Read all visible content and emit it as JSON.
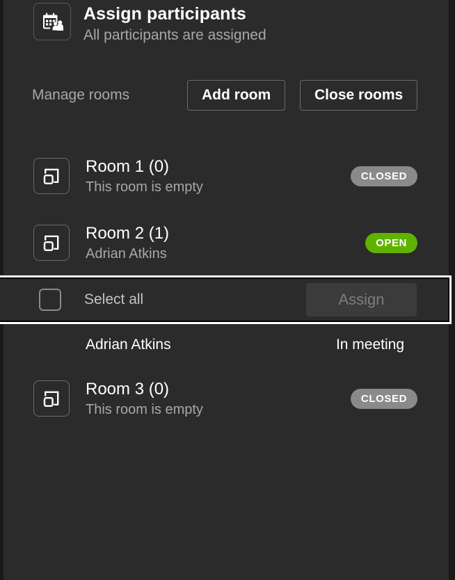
{
  "header": {
    "icon": "calendar-people-icon",
    "title": "Assign participants",
    "subtitle": "All participants are assigned"
  },
  "manage": {
    "label": "Manage rooms",
    "add_room_label": "Add room",
    "close_rooms_label": "Close rooms"
  },
  "rooms": [
    {
      "icon": "room-icon",
      "name": "Room 1 (0)",
      "description": "This room is empty",
      "status": "CLOSED",
      "status_type": "closed"
    },
    {
      "icon": "room-icon",
      "name": "Room 2 (1)",
      "description": "Adrian Atkins",
      "status": "OPEN",
      "status_type": "open"
    },
    {
      "icon": "room-icon",
      "name": "Room 3 (0)",
      "description": "This room is empty",
      "status": "CLOSED",
      "status_type": "closed"
    }
  ],
  "select_all": {
    "label": "Select all",
    "checked": false,
    "assign_label": "Assign",
    "assign_disabled": true,
    "focused": true
  },
  "participant": {
    "name": "Adrian Atkins",
    "status": "In meeting"
  },
  "colors": {
    "panel_background": "#2b2b2b",
    "page_background": "#1a1a1a",
    "text_primary": "#ffffff",
    "text_secondary": "#a8a8a8",
    "badge_closed": "#8a8a8a",
    "badge_open": "#5fb300",
    "focus_ring": "#ffffff",
    "button_disabled_bg": "#3b3b3b",
    "button_disabled_text": "#7d7d7d"
  }
}
